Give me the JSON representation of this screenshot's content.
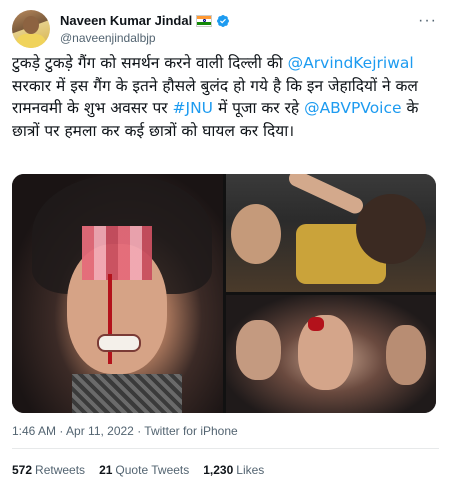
{
  "author": {
    "name": "Naveen Kumar Jindal",
    "handle": "@naveenjindalbjp",
    "verified": true,
    "flag_icon": "india-flag-icon",
    "verified_icon": "verified-badge-icon"
  },
  "menu": {
    "more_label": "···"
  },
  "tweet": {
    "segment_1": "टुकड़े टुकड़े गैंग को समर्थन करने वाली दिल्ली की ",
    "mention_1": "@ArvindKejriwal",
    "segment_2": " सरकार में इस गैंग के इतने हौसले बुलंद हो गये है कि इन जेहादियों ने कल रामनवमी के शुभ अवसर पर ",
    "hashtag_1": "#JNU",
    "segment_3": " में पूजा कर रहे ",
    "mention_2": "@ABVPVoice",
    "segment_4": " के छात्रों पर हमला कर कई छात्रों को घायल कर दिया।"
  },
  "timestamp": "1:46 AM · Apr 11, 2022 · Twitter for iPhone",
  "stats": {
    "retweets_count": "572",
    "retweets_label": "Retweets",
    "quotes_count": "21",
    "quotes_label": "Quote Tweets",
    "likes_count": "1,230",
    "likes_label": "Likes"
  },
  "colors": {
    "accent": "#1d9bf0",
    "text": "#0f1419",
    "secondary": "#536471"
  }
}
